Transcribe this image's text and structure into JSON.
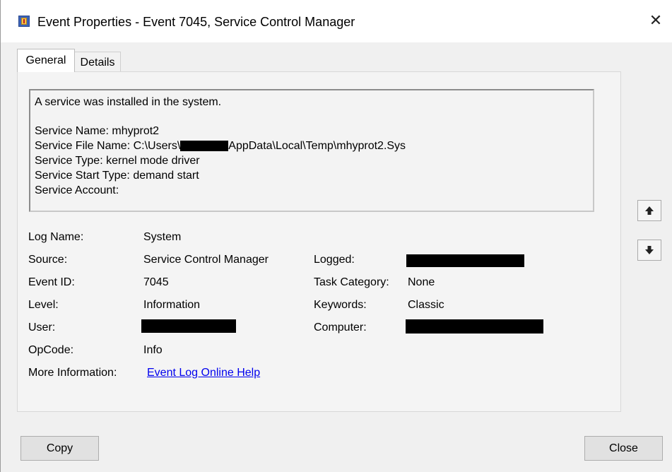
{
  "window": {
    "title": "Event Properties - Event 7045, Service Control Manager",
    "close_glyph": "✕"
  },
  "tabs": [
    {
      "label": "General",
      "selected": true
    },
    {
      "label": "Details",
      "selected": false
    }
  ],
  "description": {
    "lines": [
      "A service was installed in the system.",
      "Service Name:  mhyprot2",
      "Service File Name:  C:\\Users\\",
      "AppData\\Local\\Temp\\mhyprot2.Sys",
      "Service Type:  kernel mode driver",
      "Service Start Type:  demand start",
      "Service Account:"
    ]
  },
  "fields": {
    "log_name": {
      "label": "Log Name:",
      "value": "System"
    },
    "source": {
      "label": "Source:",
      "value": "Service Control Manager"
    },
    "event_id": {
      "label": "Event ID:",
      "value": "7045"
    },
    "level": {
      "label": "Level:",
      "value": "Information"
    },
    "user": {
      "label": "User:",
      "value": ""
    },
    "opcode": {
      "label": "OpCode:",
      "value": "Info"
    },
    "more_info": {
      "label": "More Information:",
      "value": "Event Log Online Help"
    },
    "logged": {
      "label": "Logged:",
      "value": ""
    },
    "task_category": {
      "label": "Task Category:",
      "value": "None"
    },
    "keywords": {
      "label": "Keywords:",
      "value": "Classic"
    },
    "computer": {
      "label": "Computer:",
      "value": ""
    }
  },
  "buttons": {
    "copy": "Copy",
    "close": "Close"
  },
  "icons": {
    "app": "event-viewer-icon",
    "up": "arrow-up-icon",
    "down": "arrow-down-icon"
  },
  "colors": {
    "link": "#0000ee",
    "redaction": "#000000"
  }
}
